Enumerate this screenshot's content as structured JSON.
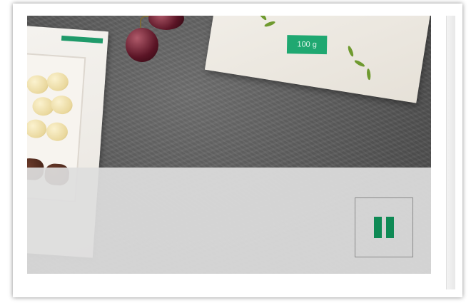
{
  "slide": {
    "product_weight_label": "100 g"
  },
  "controls": {
    "pause_icon": "pause-icon",
    "accent_color": "#0f8a55"
  }
}
